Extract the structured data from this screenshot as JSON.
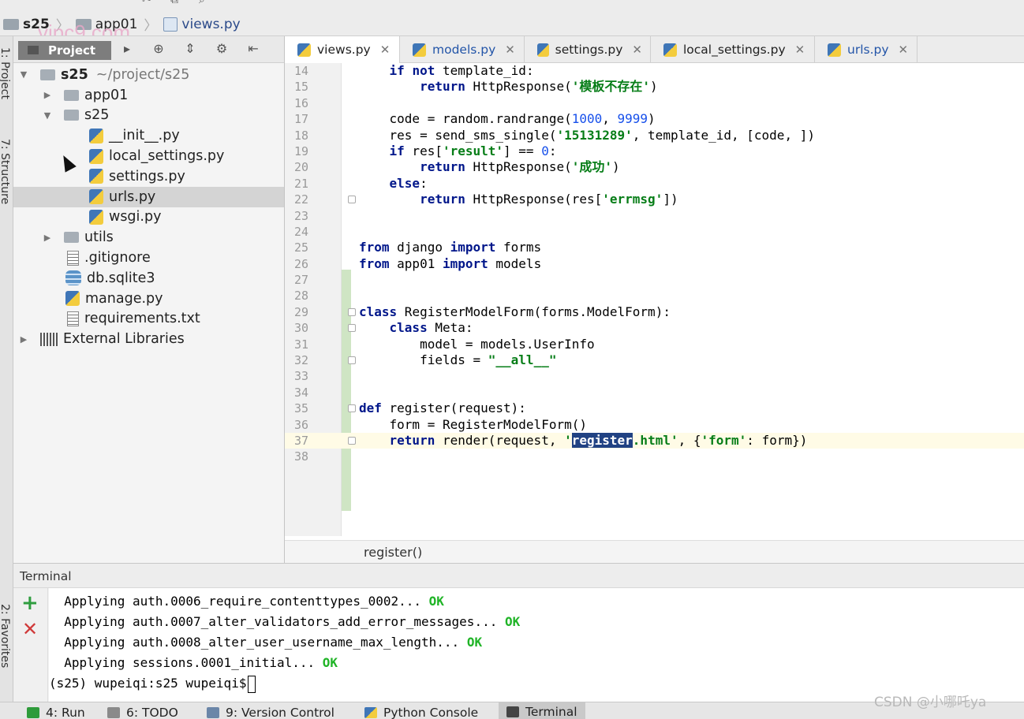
{
  "breadcrumb": [
    {
      "label": "s25"
    },
    {
      "label": "app01"
    },
    {
      "label": "views.py"
    }
  ],
  "watermark": "vipc9.com",
  "left_strip": [
    "1: Project",
    "7: Structure",
    "2: Favorites"
  ],
  "project_panel": {
    "tab_label": "Project",
    "tree": [
      {
        "label": "s25",
        "suffix": "~/project/s25"
      },
      {
        "label": "app01"
      },
      {
        "label": "s25"
      },
      {
        "label": "__init__.py"
      },
      {
        "label": "local_settings.py"
      },
      {
        "label": "settings.py"
      },
      {
        "label": "urls.py"
      },
      {
        "label": "wsgi.py"
      },
      {
        "label": "utils"
      },
      {
        "label": ".gitignore"
      },
      {
        "label": "db.sqlite3"
      },
      {
        "label": "manage.py"
      },
      {
        "label": "requirements.txt"
      },
      {
        "label": "External Libraries"
      }
    ]
  },
  "editor": {
    "tabs": [
      {
        "label": "views.py",
        "active": true
      },
      {
        "label": "models.py"
      },
      {
        "label": "settings.py"
      },
      {
        "label": "local_settings.py"
      },
      {
        "label": "urls.py"
      }
    ],
    "line_numbers": [
      "14",
      "15",
      "16",
      "17",
      "18",
      "19",
      "20",
      "21",
      "22",
      "23",
      "24",
      "25",
      "26",
      "27",
      "28",
      "29",
      "30",
      "31",
      "32",
      "33",
      "34",
      "35",
      "36",
      "37",
      "38"
    ],
    "breadcrumb_function": "register()"
  },
  "terminal": {
    "title": "Terminal",
    "lines": [
      {
        "text": "Applying auth.0006_require_contenttypes_0002...",
        "status": "OK"
      },
      {
        "text": "Applying auth.0007_alter_validators_add_error_messages...",
        "status": "OK"
      },
      {
        "text": "Applying auth.0008_alter_user_username_max_length...",
        "status": "OK"
      },
      {
        "text": "Applying sessions.0001_initial...",
        "status": "OK"
      }
    ],
    "prompt": "(s25) wupeiqi:s25 wupeiqi$"
  },
  "bottom_tabs": [
    {
      "label": "4: Run"
    },
    {
      "label": "6: TODO"
    },
    {
      "label": "9: Version Control"
    },
    {
      "label": "Python Console"
    },
    {
      "label": "Terminal",
      "active": true
    }
  ],
  "csdn_watermark": "CSDN @小哪吒ya"
}
